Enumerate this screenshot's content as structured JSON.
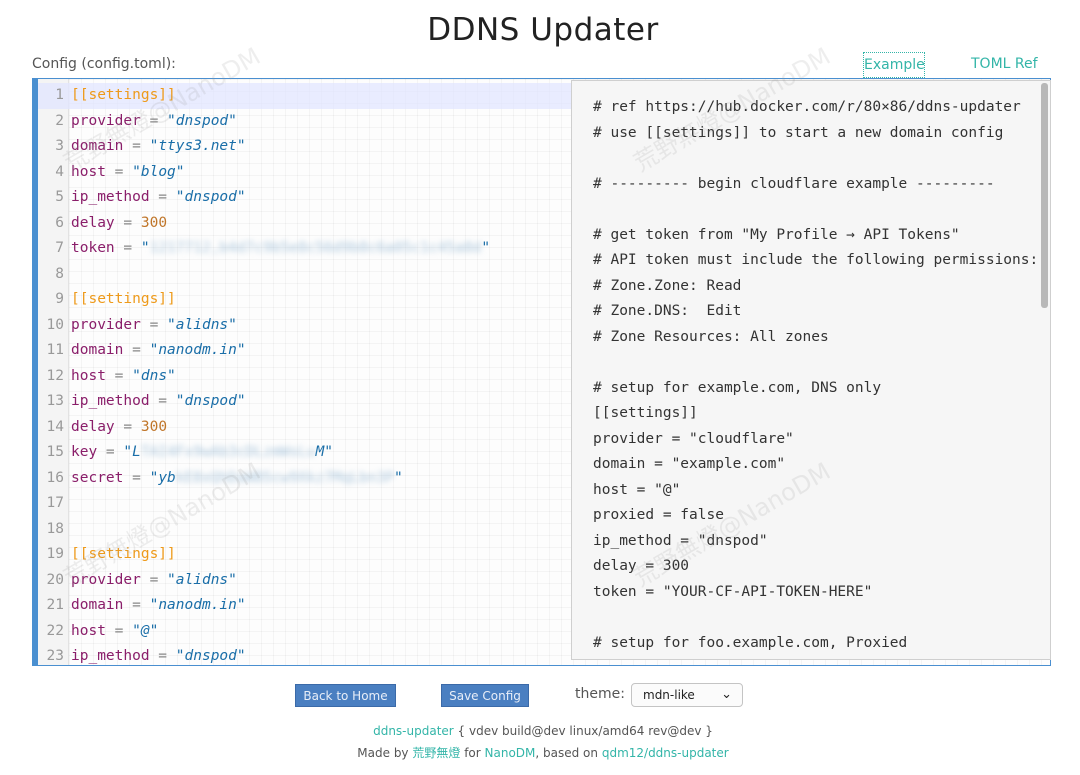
{
  "header": {
    "title": "DDNS Updater",
    "config_label": "Config (config.toml):",
    "tab_example": "Example",
    "tab_toml_ref": "TOML Ref"
  },
  "editor": {
    "lines": [
      [
        {
          "t": "[[settings]]",
          "c": "sec"
        }
      ],
      [
        {
          "t": "provider",
          "c": "key"
        },
        {
          "t": " = ",
          "c": "eq"
        },
        {
          "t": "\"dnspod\"",
          "c": "str"
        }
      ],
      [
        {
          "t": "domain",
          "c": "key"
        },
        {
          "t": " = ",
          "c": "eq"
        },
        {
          "t": "\"ttys3.net\"",
          "c": "str"
        }
      ],
      [
        {
          "t": "host",
          "c": "key"
        },
        {
          "t": " = ",
          "c": "eq"
        },
        {
          "t": "\"blog\"",
          "c": "str"
        }
      ],
      [
        {
          "t": "ip_method",
          "c": "key"
        },
        {
          "t": " = ",
          "c": "eq"
        },
        {
          "t": "\"dnspod\"",
          "c": "str"
        }
      ],
      [
        {
          "t": "delay",
          "c": "key"
        },
        {
          "t": " = ",
          "c": "eq"
        },
        {
          "t": "300",
          "c": "num"
        }
      ],
      [
        {
          "t": "token",
          "c": "key"
        },
        {
          "t": " = ",
          "c": "eq"
        },
        {
          "t": "\"",
          "c": "str"
        },
        {
          "t": "1217712,b4d7c9b5e8c56d9b8c6a05c1c45a8d",
          "c": "blur"
        },
        {
          "t": "\"",
          "c": "str"
        }
      ],
      [],
      [
        {
          "t": "[[settings]]",
          "c": "sec"
        }
      ],
      [
        {
          "t": "provider",
          "c": "key"
        },
        {
          "t": " = ",
          "c": "eq"
        },
        {
          "t": "\"alidns\"",
          "c": "str"
        }
      ],
      [
        {
          "t": "domain",
          "c": "key"
        },
        {
          "t": " = ",
          "c": "eq"
        },
        {
          "t": "\"nanodm.in\"",
          "c": "str"
        }
      ],
      [
        {
          "t": "host",
          "c": "key"
        },
        {
          "t": " = ",
          "c": "eq"
        },
        {
          "t": "\"dns\"",
          "c": "str"
        }
      ],
      [
        {
          "t": "ip_method",
          "c": "key"
        },
        {
          "t": " = ",
          "c": "eq"
        },
        {
          "t": "\"dnspod\"",
          "c": "str"
        }
      ],
      [
        {
          "t": "delay",
          "c": "key"
        },
        {
          "t": " = ",
          "c": "eq"
        },
        {
          "t": "300",
          "c": "num"
        }
      ],
      [
        {
          "t": "key",
          "c": "key"
        },
        {
          "t": " = ",
          "c": "eq"
        },
        {
          "t": "\"L",
          "c": "str"
        },
        {
          "t": "TAI4Fx9wAb3cDLzmWsLu",
          "c": "blur"
        },
        {
          "t": "M\"",
          "c": "str"
        }
      ],
      [
        {
          "t": "secret",
          "c": "key"
        },
        {
          "t": " = ",
          "c": "eq"
        },
        {
          "t": "\"yb",
          "c": "str"
        },
        {
          "t": "kE8xQhDaWB5cw9Xkz7MqLbn3P",
          "c": "blur"
        },
        {
          "t": "\"",
          "c": "str"
        }
      ],
      [],
      [],
      [
        {
          "t": "[[settings]]",
          "c": "sec"
        }
      ],
      [
        {
          "t": "provider",
          "c": "key"
        },
        {
          "t": " = ",
          "c": "eq"
        },
        {
          "t": "\"alidns\"",
          "c": "str"
        }
      ],
      [
        {
          "t": "domain",
          "c": "key"
        },
        {
          "t": " = ",
          "c": "eq"
        },
        {
          "t": "\"nanodm.in\"",
          "c": "str"
        }
      ],
      [
        {
          "t": "host",
          "c": "key"
        },
        {
          "t": " = ",
          "c": "eq"
        },
        {
          "t": "\"@\"",
          "c": "str"
        }
      ],
      [
        {
          "t": "ip_method",
          "c": "key"
        },
        {
          "t": " = ",
          "c": "eq"
        },
        {
          "t": "\"dnspod\"",
          "c": "str"
        }
      ]
    ]
  },
  "example": {
    "lines": [
      "# ref https://hub.docker.com/r/80×86/ddns-updater",
      "# use [[settings]] to start a new domain config",
      "",
      "# --------- begin cloudflare example ---------",
      "",
      "# get token from \"My Profile → API Tokens\"",
      "# API token must include the following permissions:",
      "# Zone.Zone: Read",
      "# Zone.DNS:  Edit",
      "# Zone Resources: All zones",
      "",
      "# setup for example.com, DNS only",
      "[[settings]]",
      "provider = \"cloudflare\"",
      "domain = \"example.com\"",
      "host = \"@\"",
      "proxied = false",
      "ip_method = \"dnspod\"",
      "delay = 300",
      "token = \"YOUR-CF-API-TOKEN-HERE\"",
      "",
      "# setup for foo.example.com, Proxied"
    ]
  },
  "watermark": "荒野無燈@NanoDM",
  "controls": {
    "back_home": "Back to Home",
    "save_config": "Save Config",
    "theme_label": "theme:",
    "theme_value": "mdn-like",
    "theme_chevron": "⌄"
  },
  "footer": {
    "app_link": "ddns-updater",
    "build_info": " { vdev build@dev linux/amd64 rev@dev }",
    "made_by": "Made by ",
    "author": "荒野無燈",
    "for_text": " for ",
    "org": "NanoDM",
    "based_on": ", based on ",
    "upstream": "qdm12/ddns-updater"
  }
}
